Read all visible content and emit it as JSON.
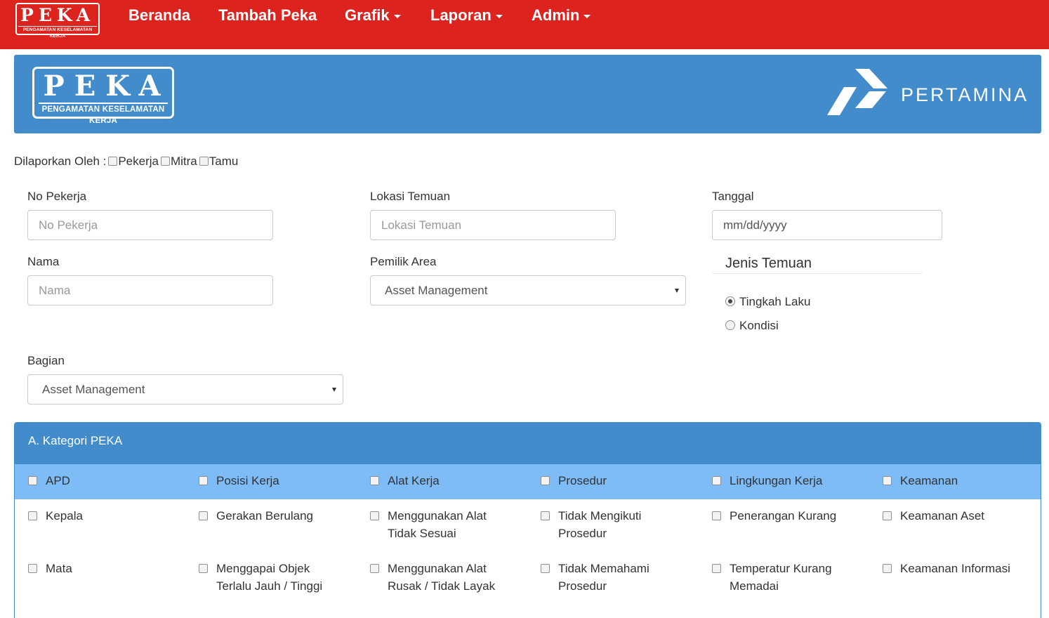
{
  "brand": {
    "logo_big": "PEKA",
    "logo_small": "PENGAMATAN KESELAMATAN KERJA",
    "partner": "PERTAMINA"
  },
  "nav": {
    "home": "Beranda",
    "add": "Tambah Peka",
    "chart": "Grafik",
    "report": "Laporan",
    "admin": "Admin"
  },
  "reported_by": {
    "label": "Dilaporkan Oleh :",
    "options": [
      "Pekerja",
      "Mitra",
      "Tamu"
    ]
  },
  "form": {
    "no_pekerja": {
      "label": "No Pekerja",
      "placeholder": "No Pekerja"
    },
    "lokasi": {
      "label": "Lokasi Temuan",
      "placeholder": "Lokasi Temuan"
    },
    "tanggal": {
      "label": "Tanggal",
      "placeholder": "mm/dd/yyyy"
    },
    "nama": {
      "label": "Nama",
      "placeholder": "Nama"
    },
    "pemilik_area": {
      "label": "Pemilik Area",
      "value": "Asset Management"
    },
    "bagian": {
      "label": "Bagian",
      "value": "Asset Management"
    },
    "jenis_temuan": {
      "legend": "Jenis Temuan",
      "options": [
        "Tingkah Laku",
        "Kondisi"
      ],
      "selected": "Tingkah Laku"
    }
  },
  "panel": {
    "title": "A. Kategori PEKA",
    "categories": [
      "APD",
      "Posisi Kerja",
      "Alat Kerja",
      "Prosedur",
      "Lingkungan Kerja",
      "Keamanan"
    ],
    "rows": [
      [
        "Kepala",
        "Gerakan Berulang",
        "Menggunakan Alat Tidak Sesuai",
        "Tidak Mengikuti Prosedur",
        "Penerangan Kurang",
        "Keamanan Aset"
      ],
      [
        "Mata",
        "Menggapai Objek Terlalu Jauh / Tinggi",
        "Menggunakan Alat Rusak / Tidak Layak",
        "Tidak Memahami Prosedur",
        "Temperatur Kurang Memadai",
        "Keamanan Informasi"
      ]
    ]
  },
  "colors": {
    "navbar": "#dd231d",
    "banner": "#438ccb",
    "category_row": "#7dbcf7"
  }
}
